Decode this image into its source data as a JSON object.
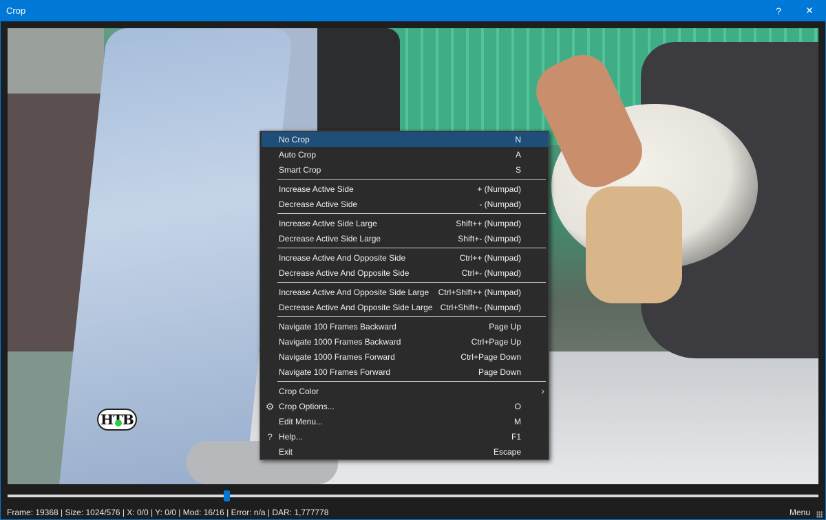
{
  "window": {
    "title": "Crop",
    "help_glyph": "?",
    "close_glyph": "✕"
  },
  "video": {
    "logo_text": "НТВ"
  },
  "context_menu": {
    "items": [
      {
        "label": "No Crop",
        "shortcut": "N",
        "highlighted": true
      },
      {
        "label": "Auto Crop",
        "shortcut": "A"
      },
      {
        "label": "Smart Crop",
        "shortcut": "S"
      },
      {
        "label": "Increase Active Side",
        "shortcut": "+ (Numpad)"
      },
      {
        "label": "Decrease Active Side",
        "shortcut": "- (Numpad)"
      },
      {
        "label": "Increase Active Side Large",
        "shortcut": "Shift++ (Numpad)"
      },
      {
        "label": "Decrease Active Side Large",
        "shortcut": "Shift+- (Numpad)"
      },
      {
        "label": "Increase Active And Opposite Side",
        "shortcut": "Ctrl++ (Numpad)"
      },
      {
        "label": "Decrease Active And Opposite Side",
        "shortcut": "Ctrl+- (Numpad)"
      },
      {
        "label": "Increase Active And Opposite Side Large",
        "shortcut": "Ctrl+Shift++ (Numpad)"
      },
      {
        "label": "Decrease Active And Opposite Side Large",
        "shortcut": "Ctrl+Shift+- (Numpad)"
      },
      {
        "label": "Navigate 100 Frames Backward",
        "shortcut": "Page Up"
      },
      {
        "label": "Navigate 1000 Frames Backward",
        "shortcut": "Ctrl+Page Up"
      },
      {
        "label": "Navigate 1000 Frames Forward",
        "shortcut": "Ctrl+Page Down"
      },
      {
        "label": "Navigate 100 Frames Forward",
        "shortcut": "Page Down"
      },
      {
        "label": "Crop Color",
        "shortcut": "",
        "submenu_glyph": "›"
      },
      {
        "label": "Crop Options...",
        "shortcut": "O",
        "icon": "gear-icon",
        "icon_glyph": "⚙"
      },
      {
        "label": "Edit Menu...",
        "shortcut": "M"
      },
      {
        "label": "Help...",
        "shortcut": "F1",
        "icon": "question-icon",
        "icon_glyph": "?"
      },
      {
        "label": "Exit",
        "shortcut": "Escape"
      }
    ]
  },
  "timeline": {
    "position_fraction": 0.27
  },
  "status": {
    "text": "Frame: 19368  |  Size: 1024/576  |  X: 0/0  |  Y: 0/0  |  Mod: 16/16  |  Error: n/a  |  DAR: 1,777778",
    "menu_label": "Menu"
  },
  "colors": {
    "accent": "#0078d7",
    "menu_bg": "#2b2b2b",
    "menu_highlight": "#1f4f78"
  }
}
